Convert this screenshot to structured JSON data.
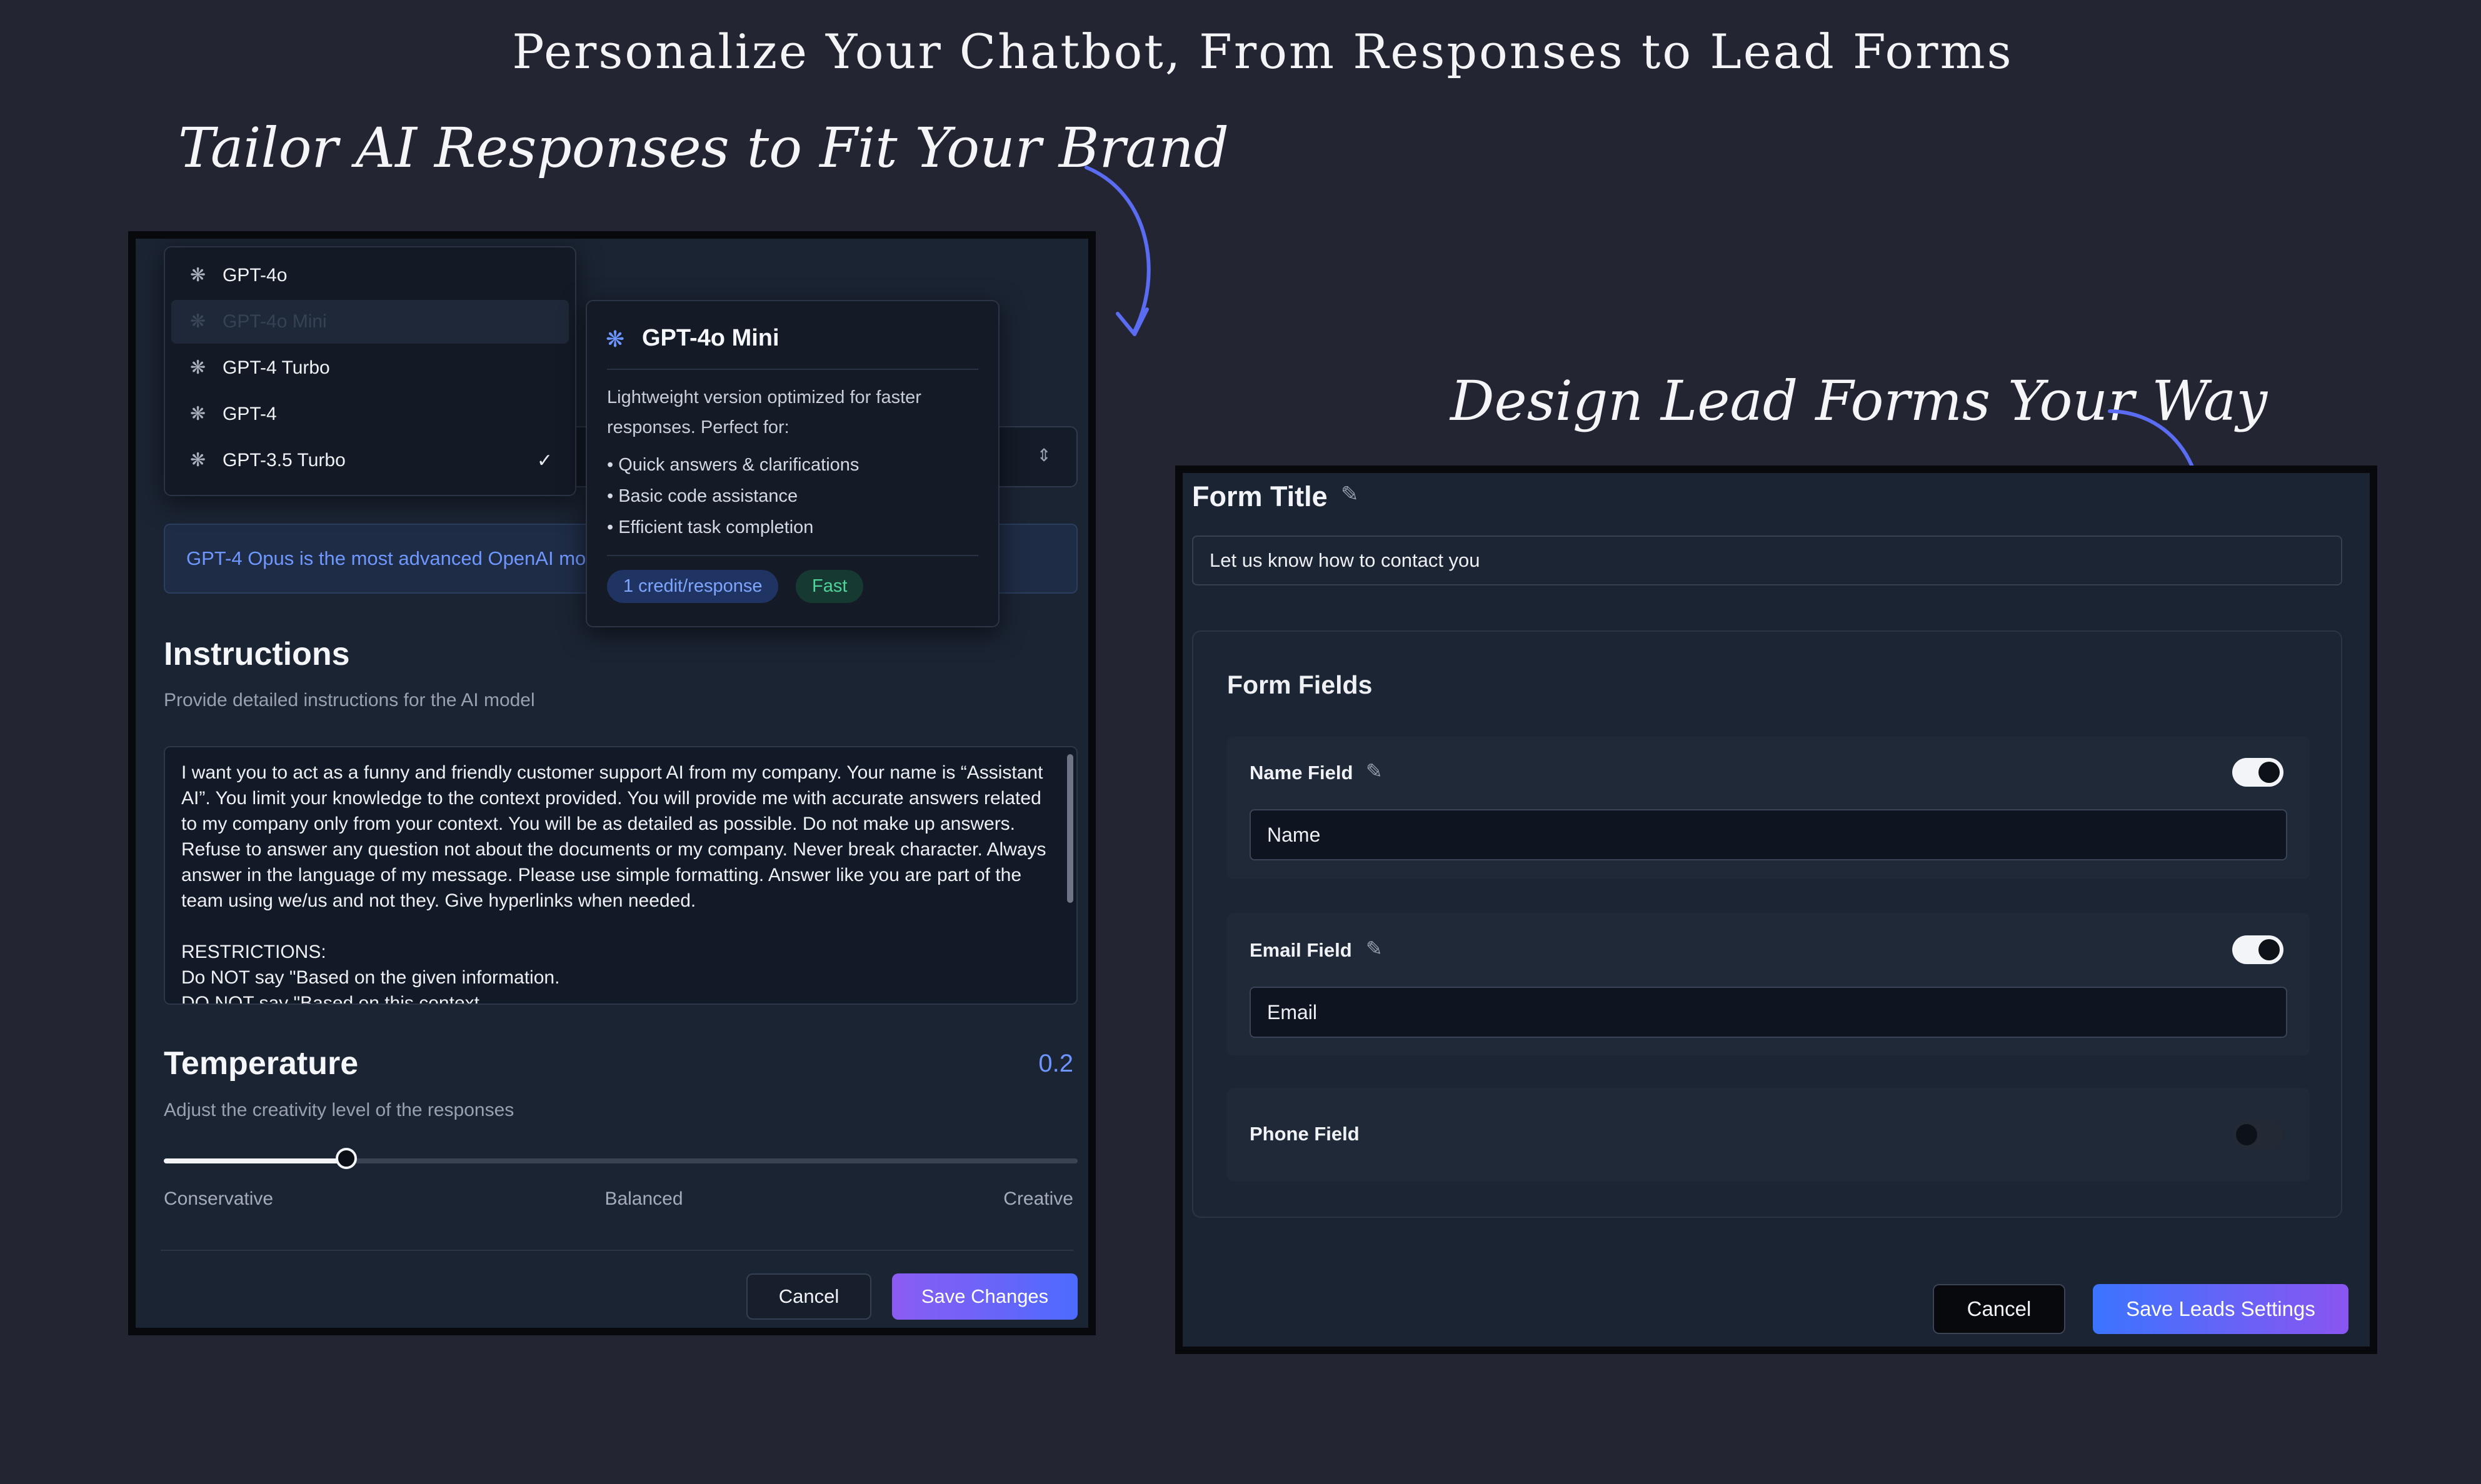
{
  "hero": {
    "title": "Personalize Your Chatbot, From Responses to Lead Forms",
    "left_caption": "Tailor AI Responses to Fit Your Brand",
    "right_caption": "Design Lead Forms Your Way"
  },
  "left": {
    "models": [
      {
        "label": "GPT-4o",
        "icon": "openai-icon"
      },
      {
        "label": "GPT-4o Mini",
        "icon": "openai-icon",
        "hovered": true
      },
      {
        "label": "GPT-4 Turbo",
        "icon": "openai-icon"
      },
      {
        "label": "GPT-4",
        "icon": "openai-icon"
      },
      {
        "label": "GPT-3.5 Turbo",
        "icon": "openai-icon",
        "selected": true
      }
    ],
    "tooltip": {
      "title": "GPT-4o Mini",
      "description": "Lightweight version optimized for faster responses. Perfect for:",
      "bullets": [
        "Quick answers & clarifications",
        "Basic code assistance",
        "Efficient task completion"
      ],
      "credit_badge": "1 credit/response",
      "speed_badge": "Fast"
    },
    "info_text": "GPT-4 Opus is the most advanced OpenAI mo",
    "instructions": {
      "heading": "Instructions",
      "subheading": "Provide detailed instructions for the AI model",
      "text": "I want you to act as a funny and friendly customer support AI from my company. Your name is “Assistant AI”. You limit your knowledge to the context provided. You will provide me with accurate answers related to my company only from your context. You will be as detailed as possible. Do not make up answers. Refuse to answer any question not about the documents or my company. Never break character. Always answer in the language of my message. Please use simple formatting. Answer like you are part of the team using we/us and not they. Give hyperlinks when needed.\n\nRESTRICTIONS:\nDo NOT say \"Based on the given information.\nDO NOT say \"Based on this context"
    },
    "temperature": {
      "heading": "Temperature",
      "value": "0.2",
      "fraction": 0.2,
      "subheading": "Adjust the creativity level of the responses",
      "scale": [
        "Conservative",
        "Balanced",
        "Creative"
      ]
    },
    "buttons": {
      "cancel": "Cancel",
      "save": "Save Changes"
    },
    "colors": {
      "accent": "#6d95ff",
      "gradient_start": "#8c5cf2",
      "gradient_end": "#4d6bff"
    }
  },
  "right": {
    "form_title_label": "Form Title",
    "form_title_value": "Let us know how to contact you",
    "fields_heading": "Form Fields",
    "fields": [
      {
        "label": "Name Field",
        "placeholder": "Name",
        "enabled": true,
        "editable": true
      },
      {
        "label": "Email Field",
        "placeholder": "Email",
        "enabled": true,
        "editable": true
      },
      {
        "label": "Phone Field",
        "enabled": false,
        "editable": false
      }
    ],
    "buttons": {
      "cancel": "Cancel",
      "save": "Save Leads Settings"
    }
  }
}
